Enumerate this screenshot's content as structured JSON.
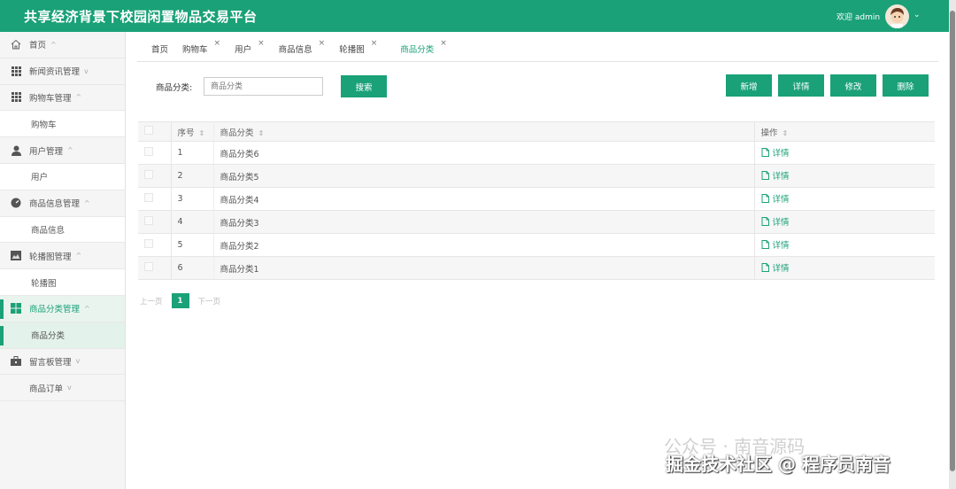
{
  "header": {
    "title": "共享经济背景下校园闲置物品交易平台",
    "welcome": "欢迎 admin"
  },
  "sidebar": {
    "items": [
      {
        "label": "首页",
        "arrow": "^",
        "icon": "home-icon"
      },
      {
        "label": "新闻资讯管理",
        "arrow": "v",
        "icon": "grid-icon"
      },
      {
        "label": "购物车管理",
        "arrow": "^",
        "icon": "grid-icon"
      },
      {
        "label": "购物车",
        "sub": true
      },
      {
        "label": "用户管理",
        "arrow": "^",
        "icon": "user-icon"
      },
      {
        "label": "用户",
        "sub": true
      },
      {
        "label": "商品信息管理",
        "arrow": "^",
        "icon": "gauge-icon"
      },
      {
        "label": "商品信息",
        "sub": true
      },
      {
        "label": "轮播图管理",
        "arrow": "^",
        "icon": "image-icon"
      },
      {
        "label": "轮播图",
        "sub": true
      },
      {
        "label": "商品分类管理",
        "arrow": "^",
        "icon": "tiles-icon",
        "active": true
      },
      {
        "label": "商品分类",
        "sub": true,
        "active": true
      },
      {
        "label": "留言板管理",
        "arrow": "v",
        "icon": "briefcase-icon"
      },
      {
        "label": "商品订单",
        "arrow": "v"
      }
    ]
  },
  "tabs": [
    {
      "label": "首页"
    },
    {
      "label": "购物车",
      "close": "×"
    },
    {
      "label": "用户",
      "close": "×"
    },
    {
      "label": "商品信息",
      "close": "×"
    },
    {
      "label": "轮播图",
      "close": "×"
    },
    {
      "label": "商品分类",
      "close": "×",
      "active": true
    }
  ],
  "search": {
    "label": "商品分类:",
    "placeholder": "商品分类",
    "button": "搜索"
  },
  "actions": {
    "add": "新增",
    "detail": "详情",
    "edit": "修改",
    "delete": "删除"
  },
  "table": {
    "headers": [
      "序号",
      "商品分类",
      "操作"
    ],
    "rows": [
      {
        "index": "1",
        "category": "商品分类6",
        "action": "详情"
      },
      {
        "index": "2",
        "category": "商品分类5",
        "action": "详情"
      },
      {
        "index": "3",
        "category": "商品分类4",
        "action": "详情"
      },
      {
        "index": "4",
        "category": "商品分类3",
        "action": "详情"
      },
      {
        "index": "5",
        "category": "商品分类2",
        "action": "详情"
      },
      {
        "index": "6",
        "category": "商品分类1",
        "action": "详情"
      }
    ]
  },
  "pager": {
    "prev": "上一页",
    "current": "1",
    "next": "下一页"
  },
  "watermark": {
    "line1": "公众号 · 南音源码",
    "line2": "掘金技术社区 @ 程序员南音"
  },
  "colors": {
    "primary": "#1aa178"
  }
}
